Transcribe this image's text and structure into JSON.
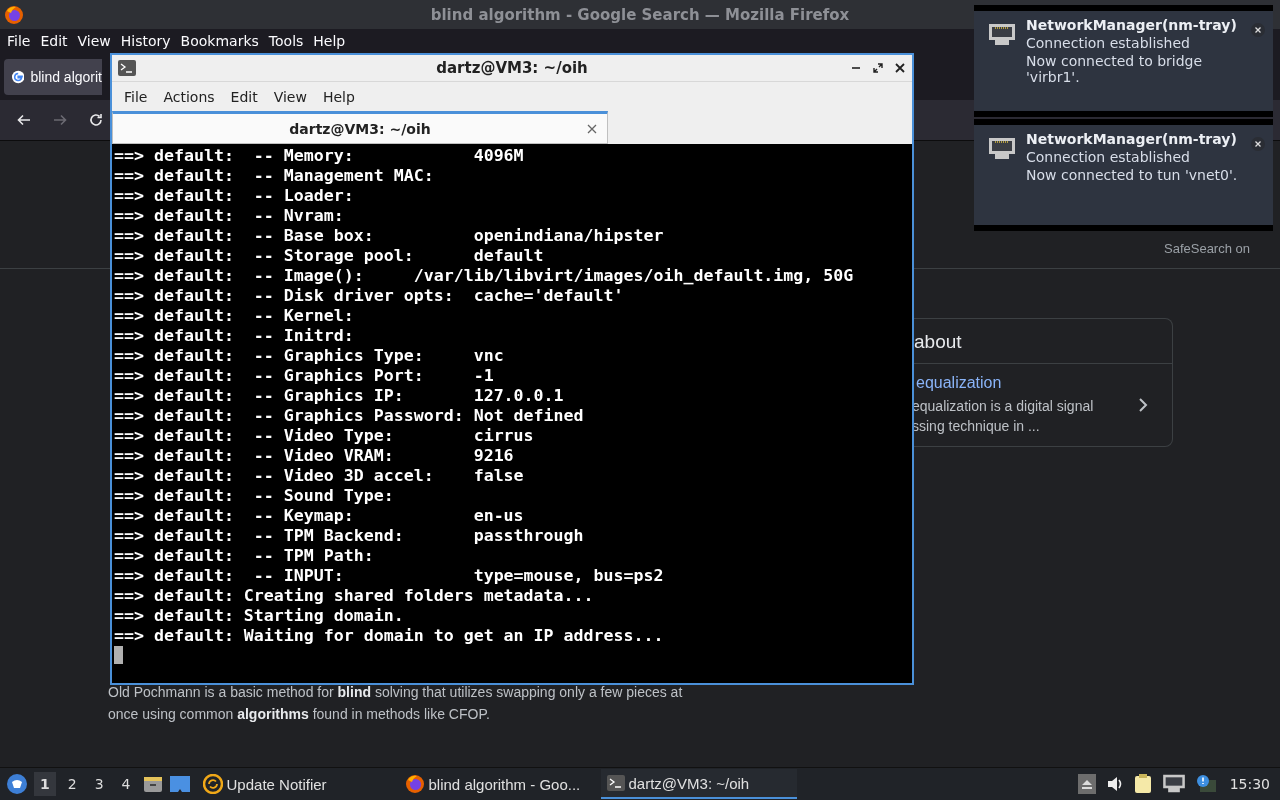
{
  "browser": {
    "title": "blind algorithm - Google Search — Mozilla Firefox",
    "menu": [
      "File",
      "Edit",
      "View",
      "History",
      "Bookmarks",
      "Tools",
      "Help"
    ],
    "tab": {
      "label": "blind algorit"
    },
    "nav": {
      "forward_disabled": true
    },
    "safesearch": "SafeSearch on",
    "card": {
      "heading": "about",
      "link": "equalization",
      "snippet_lines": [
        "equalization is a digital signal",
        "ssing technique in ..."
      ]
    },
    "snippet": "Old Pochmann is a basic method for **blind** solving that utilizes swapping only a few pieces at once using common **algorithms** found in methods like CFOP."
  },
  "terminal": {
    "title": "dartz@VM3: ~/oih",
    "menu": [
      "File",
      "Actions",
      "Edit",
      "View",
      "Help"
    ],
    "tab": {
      "label": "dartz@VM3: ~/oih",
      "selected": true
    },
    "lines": [
      "==> default:  -- Memory:            4096M",
      "==> default:  -- Management MAC:",
      "==> default:  -- Loader:",
      "==> default:  -- Nvram:",
      "==> default:  -- Base box:          openindiana/hipster",
      "==> default:  -- Storage pool:      default",
      "==> default:  -- Image():     /var/lib/libvirt/images/oih_default.img, 50G",
      "==> default:  -- Disk driver opts:  cache='default'",
      "==> default:  -- Kernel:",
      "==> default:  -- Initrd:",
      "==> default:  -- Graphics Type:     vnc",
      "==> default:  -- Graphics Port:     -1",
      "==> default:  -- Graphics IP:       127.0.0.1",
      "==> default:  -- Graphics Password: Not defined",
      "==> default:  -- Video Type:        cirrus",
      "==> default:  -- Video VRAM:        9216",
      "==> default:  -- Video 3D accel:    false",
      "==> default:  -- Sound Type:",
      "==> default:  -- Keymap:            en-us",
      "==> default:  -- TPM Backend:       passthrough",
      "==> default:  -- TPM Path:",
      "==> default:  -- INPUT:             type=mouse, bus=ps2",
      "==> default: Creating shared folders metadata...",
      "==> default: Starting domain.",
      "==> default: Waiting for domain to get an IP address..."
    ]
  },
  "notifications": [
    {
      "app": "NetworkManager(nm-tray)",
      "summary": "Connection established",
      "body": "Now connected to bridge 'virbr1'."
    },
    {
      "app": "NetworkManager(nm-tray)",
      "summary": "Connection established",
      "body": "Now connected to tun 'vnet0'."
    }
  ],
  "taskbar": {
    "workspaces": [
      {
        "label": "1",
        "selected": true
      },
      {
        "label": "2",
        "selected": false
      },
      {
        "label": "3",
        "selected": false
      },
      {
        "label": "4",
        "selected": false
      }
    ],
    "tasks": [
      {
        "kind": "notifier",
        "label": "Update Notifier",
        "selected": false
      },
      {
        "kind": "browser",
        "label": "blind algorithm - Goo...",
        "selected": false
      },
      {
        "kind": "terminal",
        "label": "dartz@VM3: ~/oih",
        "selected": true
      }
    ],
    "clock": "15:30"
  }
}
